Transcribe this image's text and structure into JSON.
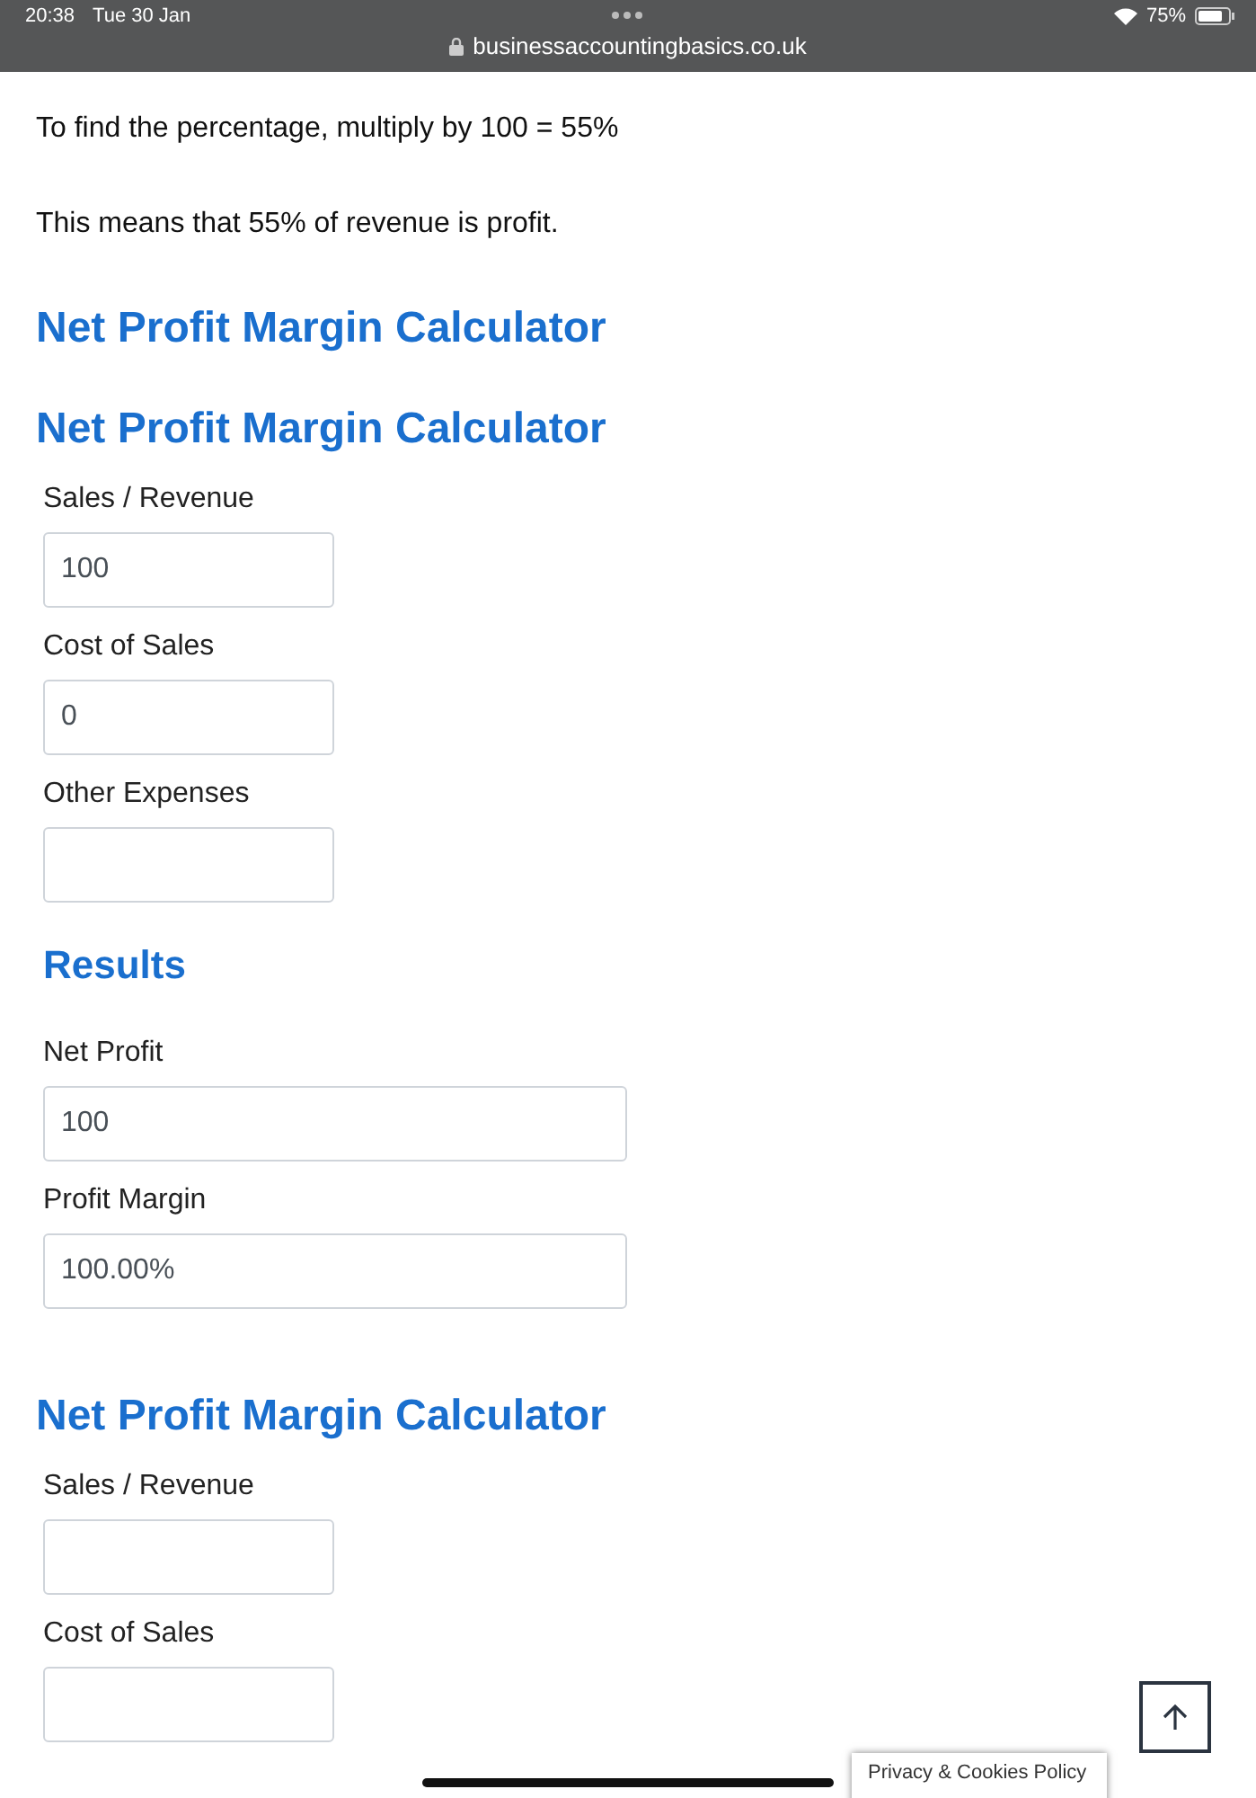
{
  "status_bar": {
    "time": "20:38",
    "date": "Tue 30 Jan",
    "url": "businessaccountingbasics.co.uk",
    "battery": "75%"
  },
  "paragraphs": [
    "To find the percentage, multiply by 100 = 55%",
    "This means that 55% of revenue is profit."
  ],
  "heading": "Net Profit Margin Calculator",
  "calculators": [
    {
      "title": "Net Profit Margin Calculator",
      "fields": [
        {
          "label": "Sales / Revenue",
          "value": "100"
        },
        {
          "label": "Cost of Sales",
          "value": "0"
        },
        {
          "label": "Other Expenses"
        }
      ],
      "results_title": "Results",
      "results": [
        {
          "label": "Net Profit",
          "value": "100"
        },
        {
          "label": "Profit Margin",
          "value": "100.00%"
        }
      ]
    },
    {
      "title": "Net Profit Margin Calculator",
      "fields": [
        {
          "label": "Sales / Revenue"
        },
        {
          "label": "Cost of Sales"
        }
      ]
    }
  ],
  "privacy_tab": "Privacy & Cookies Policy"
}
